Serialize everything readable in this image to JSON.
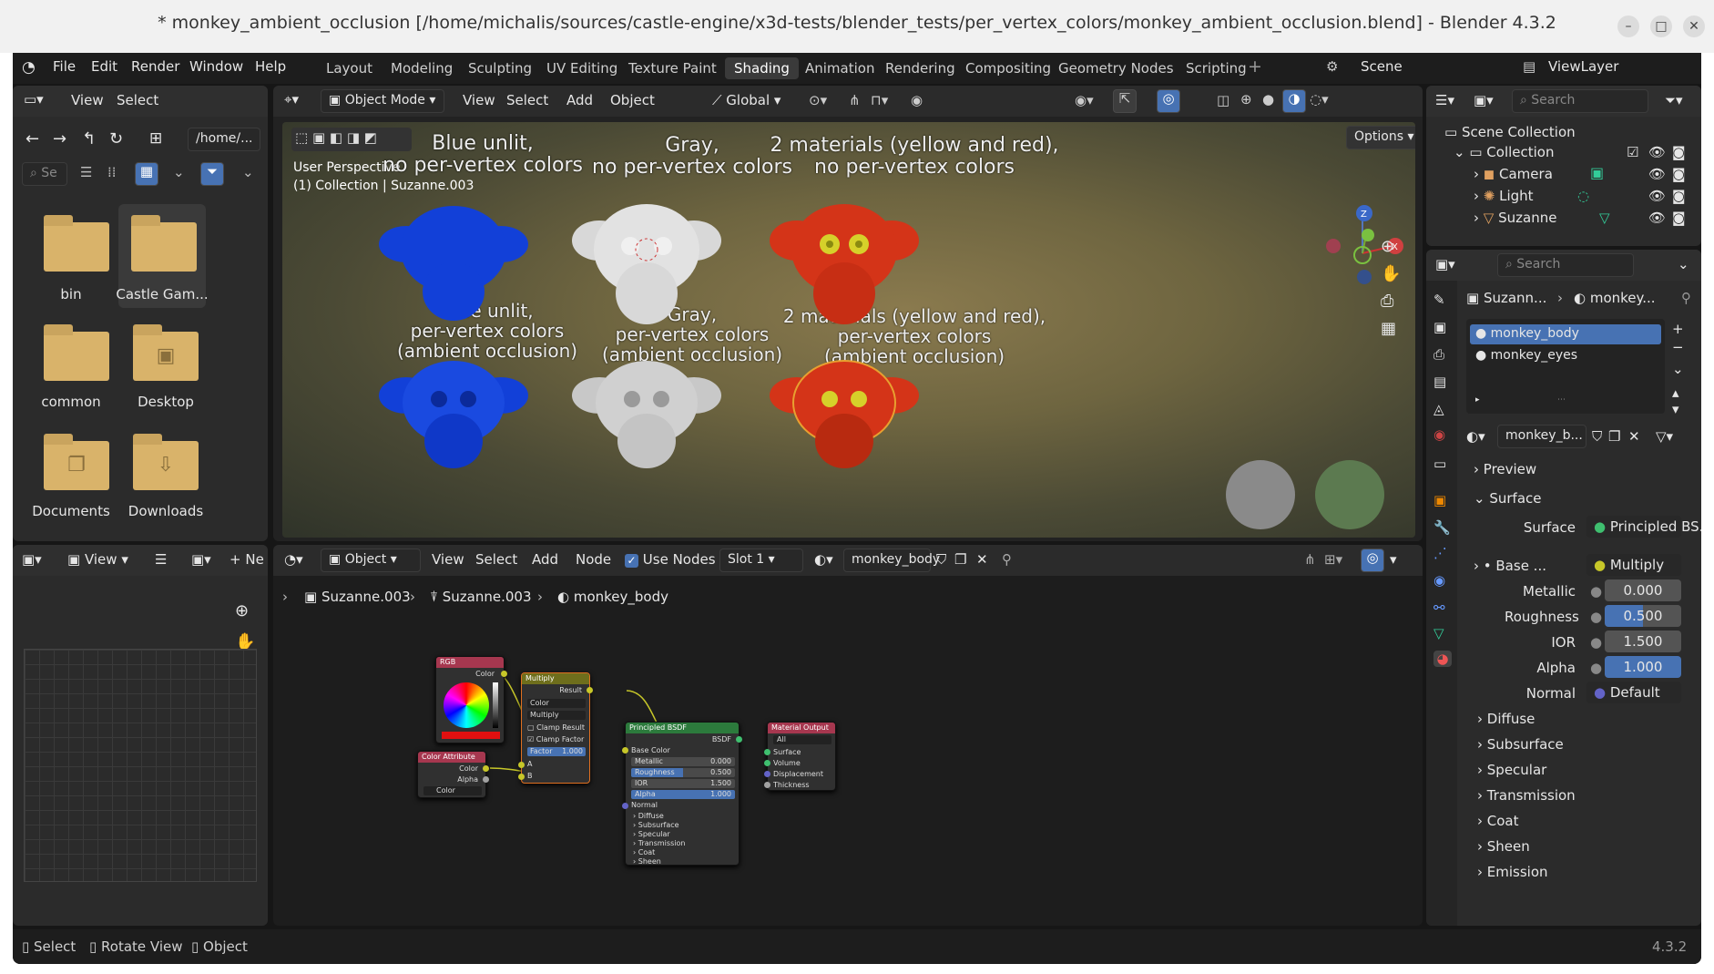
{
  "window": {
    "title": "* monkey_ambient_occlusion [/home/michalis/sources/castle-engine/x3d-tests/blender_tests/per_vertex_colors/monkey_ambient_occlusion.blend] - Blender 4.3.2"
  },
  "menu": [
    "File",
    "Edit",
    "Render",
    "Window",
    "Help"
  ],
  "workspaces": [
    "Layout",
    "Modeling",
    "Sculpting",
    "UV Editing",
    "Texture Paint",
    "Shading",
    "Animation",
    "Rendering",
    "Compositing",
    "Geometry Nodes",
    "Scripting"
  ],
  "active_workspace": "Shading",
  "scene": {
    "scene_name": "Scene",
    "view_layer": "ViewLayer"
  },
  "file_browser": {
    "menu_view": "View",
    "menu_select": "Select",
    "path": "/home/...",
    "search_placeholder": "Se",
    "items": [
      {
        "name": "bin",
        "icon": "folder-icon"
      },
      {
        "name": "Castle Gam...",
        "icon": "folder-icon"
      },
      {
        "name": "common",
        "icon": "folder-icon"
      },
      {
        "name": "Desktop",
        "icon": "desktop-folder-icon"
      },
      {
        "name": "Documents",
        "icon": "documents-folder-icon"
      },
      {
        "name": "Downloads",
        "icon": "downloads-folder-icon"
      }
    ]
  },
  "viewport": {
    "mode": "Object Mode",
    "menus": [
      "View",
      "Select",
      "Add",
      "Object"
    ],
    "transform": "Global",
    "options": "Options",
    "info_line1": "User Perspective",
    "info_line2": "(1) Collection | Suzanne.003",
    "labels_top": [
      "Blue unlit,\nno per-vertex colors",
      "Gray,\nno per-vertex colors",
      "2 materials (yellow and red),\nno per-vertex colors"
    ],
    "labels_bottom": [
      "Blue unlit,\nper-vertex colors\n(ambient occlusion)",
      "Gray,\nper-vertex colors\n(ambient occlusion)",
      "2 materials (yellow and red),\nper-vertex colors\n(ambient occlusion)"
    ],
    "colors": {
      "blue": "#1240d8",
      "gray": "#d8d8d8",
      "red": "#d43418",
      "eye": "#d6d02a"
    }
  },
  "image_editor": {
    "view": "View",
    "new": "Ne"
  },
  "node_editor": {
    "type": "Object",
    "menus": [
      "View",
      "Select",
      "Add",
      "Node"
    ],
    "use_nodes": "Use Nodes",
    "slot": "Slot 1",
    "material": "monkey_body",
    "breadcrumb": [
      "Suzanne.003",
      "Suzanne.003",
      "monkey_body"
    ],
    "nodes": {
      "rgb": {
        "title": "RGB",
        "out": "Color"
      },
      "multiply": {
        "title": "Multiply",
        "out": "Result",
        "sel1": "Color",
        "sel2": "Multiply",
        "clamp_result": "Clamp Result",
        "clamp_factor": "Clamp Factor",
        "factor_label": "Factor",
        "factor": "1.000",
        "in_a": "A",
        "in_b": "B"
      },
      "color_attr": {
        "title": "Color Attribute",
        "out1": "Color",
        "out2": "Alpha",
        "field": "Color"
      },
      "bsdf": {
        "title": "Principled BSDF",
        "out": "BSDF",
        "base": "Base Color",
        "metallic": "Metallic",
        "metallic_v": "0.000",
        "rough": "Roughness",
        "rough_v": "0.500",
        "ior": "IOR",
        "ior_v": "1.500",
        "alpha": "Alpha",
        "alpha_v": "1.000",
        "normal": "Normal",
        "subs": [
          "Diffuse",
          "Subsurface",
          "Specular",
          "Transmission",
          "Coat",
          "Sheen"
        ]
      },
      "output": {
        "title": "Material Output",
        "target": "All",
        "ins": [
          "Surface",
          "Volume",
          "Displacement",
          "Thickness"
        ]
      }
    }
  },
  "outliner": {
    "search": "Search",
    "root": "Scene Collection",
    "collection": "Collection",
    "items": [
      "Camera",
      "Light",
      "Suzanne"
    ]
  },
  "properties": {
    "search": "Search",
    "crumb_obj": "Suzann...",
    "crumb_mat": "monkey...",
    "slots": [
      "monkey_body",
      "monkey_eyes"
    ],
    "material_field": "monkey_b...",
    "preview": "Preview",
    "surface_section": "Surface",
    "surface_label": "Surface",
    "surface_value": "Principled BS...",
    "base_label": "Base ...",
    "base_value": "Multiply",
    "metallic_label": "Metallic",
    "metallic": "0.000",
    "roughness_label": "Roughness",
    "roughness": "0.500",
    "ior_label": "IOR",
    "ior": "1.500",
    "alpha_label": "Alpha",
    "alpha": "1.000",
    "normal_label": "Normal",
    "normal_value": "Default",
    "subsections": [
      "Diffuse",
      "Subsurface",
      "Specular",
      "Transmission",
      "Coat",
      "Sheen",
      "Emission"
    ]
  },
  "status": {
    "select": "Select",
    "rotate": "Rotate View",
    "object": "Object",
    "version": "4.3.2"
  }
}
